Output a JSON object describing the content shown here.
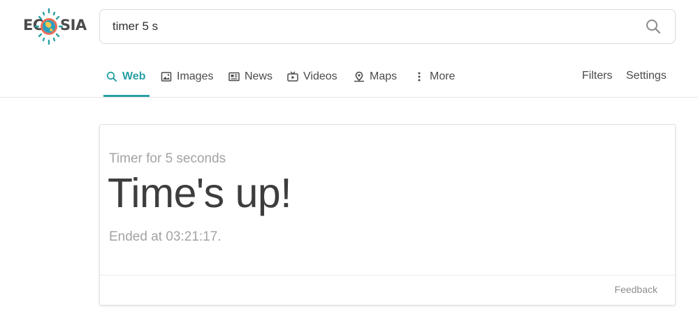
{
  "brand": {
    "logo_left": "EC",
    "logo_right": "SIA",
    "accent_color": "#2aa0a4"
  },
  "search": {
    "query": "timer 5 s",
    "icon": "search-icon"
  },
  "tabs": [
    {
      "label": "Web",
      "icon": "search-icon",
      "active": true
    },
    {
      "label": "Images",
      "icon": "image-icon",
      "active": false
    },
    {
      "label": "News",
      "icon": "newspaper-icon",
      "active": false
    },
    {
      "label": "Videos",
      "icon": "video-icon",
      "active": false
    },
    {
      "label": "Maps",
      "icon": "map-pin-icon",
      "active": false
    },
    {
      "label": "More",
      "icon": "more-vertical-icon",
      "active": false
    }
  ],
  "header_links": {
    "filters": "Filters",
    "settings": "Settings"
  },
  "timer_card": {
    "label": "Timer for 5 seconds",
    "status": "Time's up!",
    "ended": "Ended at 03:21:17.",
    "feedback": "Feedback"
  }
}
